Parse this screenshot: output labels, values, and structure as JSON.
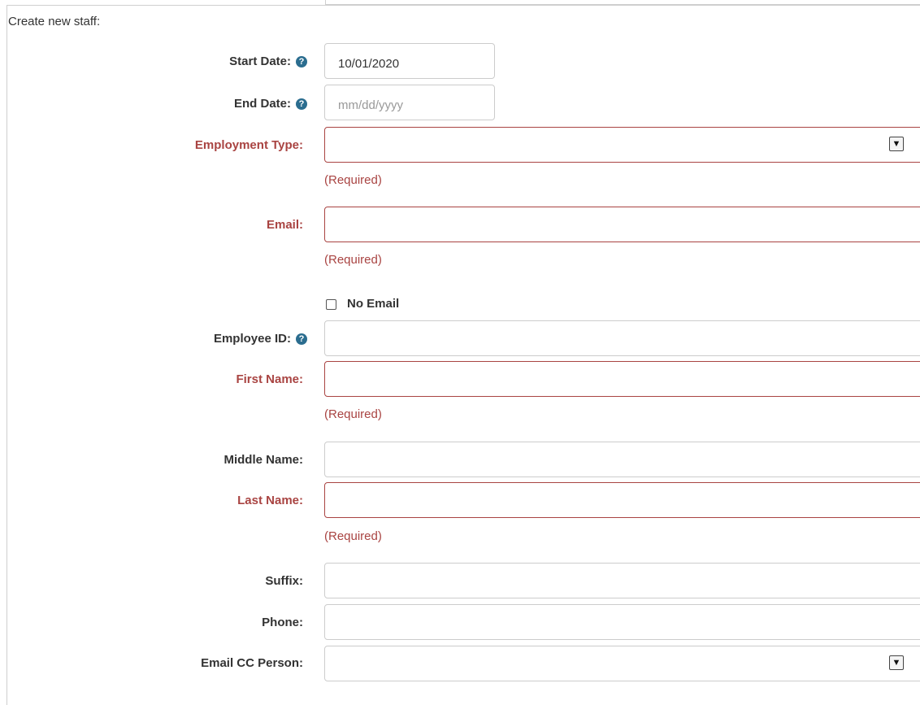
{
  "form": {
    "title": "Create new staff:",
    "required_text": "(Required)",
    "start_date": {
      "label": "Start Date:",
      "value": "10/01/2020",
      "help_icon": "question-circle-icon"
    },
    "end_date": {
      "label": "End Date:",
      "placeholder": "mm/dd/yyyy",
      "help_icon": "question-circle-icon"
    },
    "employment_type": {
      "label": "Employment Type:",
      "value": ""
    },
    "email": {
      "label": "Email:",
      "value": ""
    },
    "no_email": {
      "label": "No Email",
      "checked": false
    },
    "employee_id": {
      "label": "Employee ID:",
      "value": "",
      "help_icon": "question-circle-icon"
    },
    "first_name": {
      "label": "First Name:",
      "value": ""
    },
    "middle_name": {
      "label": "Middle Name:",
      "value": ""
    },
    "last_name": {
      "label": "Last Name:",
      "value": ""
    },
    "suffix": {
      "label": "Suffix:",
      "value": ""
    },
    "phone": {
      "label": "Phone:",
      "value": ""
    },
    "email_cc_person": {
      "label": "Email CC Person:",
      "value": ""
    }
  },
  "colors": {
    "required_red": "#a94442",
    "help_icon_blue": "#2b6d8f",
    "text": "#333333",
    "border": "#cccccc"
  }
}
